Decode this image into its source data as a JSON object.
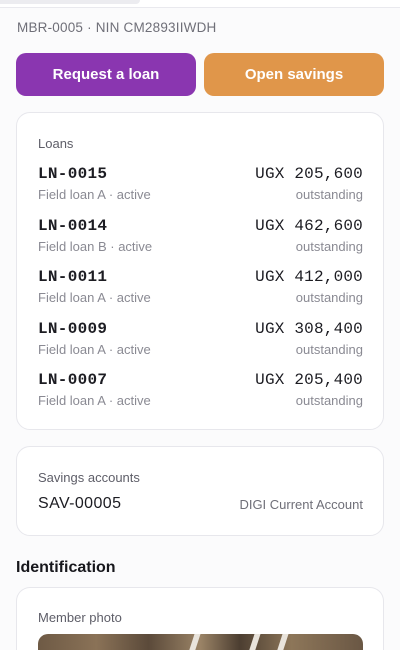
{
  "member": {
    "meta": "MBR-0005 · NIN CM2893IIWDH"
  },
  "actions": {
    "request_loan": "Request a loan",
    "open_savings": "Open savings"
  },
  "loans": {
    "title": "Loans",
    "items": [
      {
        "id": "LN-0015",
        "product": "Field loan A · active",
        "amount": "UGX 205,600",
        "status": "outstanding"
      },
      {
        "id": "LN-0014",
        "product": "Field loan B · active",
        "amount": "UGX 462,600",
        "status": "outstanding"
      },
      {
        "id": "LN-0011",
        "product": "Field loan A · active",
        "amount": "UGX 412,000",
        "status": "outstanding"
      },
      {
        "id": "LN-0009",
        "product": "Field loan A · active",
        "amount": "UGX 308,400",
        "status": "outstanding"
      },
      {
        "id": "LN-0007",
        "product": "Field loan A · active",
        "amount": "UGX 205,400",
        "status": "outstanding"
      }
    ]
  },
  "savings": {
    "title": "Savings accounts",
    "items": [
      {
        "id": "SAV-00005",
        "type": "DIGI Current Account"
      }
    ]
  },
  "identification": {
    "title": "Identification",
    "photo_card_title": "Member photo"
  },
  "colors": {
    "loan_button": "#8a36b0",
    "savings_button": "#e0964a"
  }
}
